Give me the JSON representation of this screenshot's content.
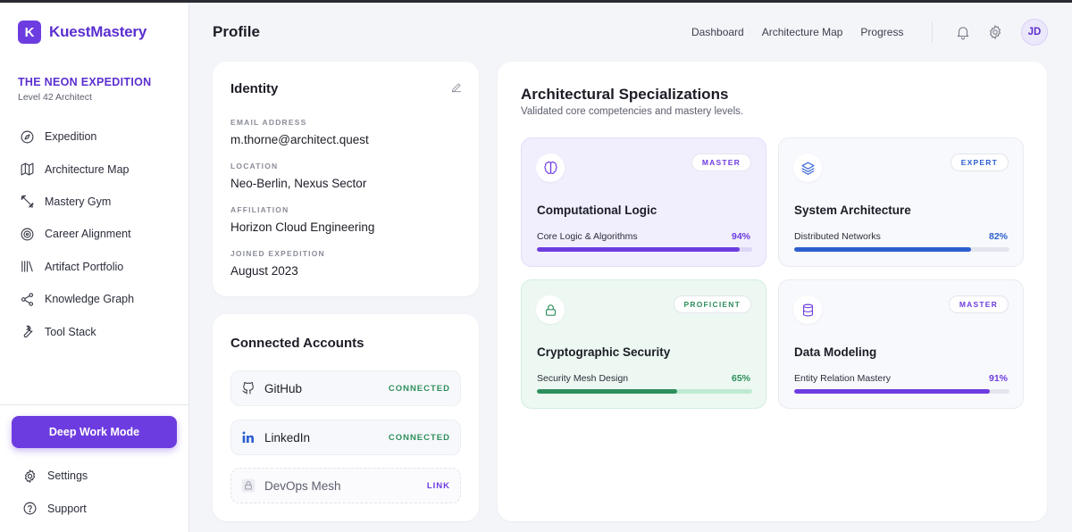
{
  "brand": {
    "logo_letter": "K",
    "name": "KuestMastery"
  },
  "expedition": {
    "title": "THE NEON EXPEDITION",
    "subtitle": "Level 42 Architect"
  },
  "sidebar": {
    "items": [
      {
        "label": "Expedition",
        "icon": "compass-icon"
      },
      {
        "label": "Architecture Map",
        "icon": "map-icon"
      },
      {
        "label": "Mastery Gym",
        "icon": "dumbbell-icon"
      },
      {
        "label": "Career Alignment",
        "icon": "target-icon"
      },
      {
        "label": "Artifact Portfolio",
        "icon": "library-icon"
      },
      {
        "label": "Knowledge Graph",
        "icon": "share-icon"
      },
      {
        "label": "Tool Stack",
        "icon": "wrench-icon"
      }
    ],
    "deep_work_label": "Deep Work Mode",
    "bottom_items": [
      {
        "label": "Settings",
        "icon": "gear-icon"
      },
      {
        "label": "Support",
        "icon": "help-icon"
      }
    ]
  },
  "header": {
    "title": "Profile",
    "nav": [
      "Dashboard",
      "Architecture Map",
      "Progress"
    ],
    "avatar_initials": "JD"
  },
  "identity": {
    "title": "Identity",
    "fields": [
      {
        "label": "EMAIL ADDRESS",
        "value": "m.thorne@architect.quest"
      },
      {
        "label": "LOCATION",
        "value": "Neo-Berlin, Nexus Sector"
      },
      {
        "label": "AFFILIATION",
        "value": "Horizon Cloud Engineering"
      },
      {
        "label": "JOINED EXPEDITION",
        "value": "August 2023"
      }
    ]
  },
  "accounts": {
    "title": "Connected Accounts",
    "items": [
      {
        "name": "GitHub",
        "status": "CONNECTED",
        "icon": "github-icon"
      },
      {
        "name": "LinkedIn",
        "status": "CONNECTED",
        "icon": "linkedin-icon"
      },
      {
        "name": "DevOps Mesh",
        "status": "LINK",
        "icon": "lock-icon"
      }
    ]
  },
  "specializations": {
    "title": "Architectural Specializations",
    "subtitle": "Validated core competencies and mastery levels.",
    "tiles": [
      {
        "name": "Computational Logic",
        "badge": "MASTER",
        "skill": "Core Logic & Algorithms",
        "percent_label": "94%",
        "progress": 0.94,
        "icon": "brain-icon",
        "accent": "#6d3ce0"
      },
      {
        "name": "System Architecture",
        "badge": "EXPERT",
        "skill": "Distributed Networks",
        "percent_label": "82%",
        "progress": 0.82,
        "icon": "layers-icon",
        "accent": "#2d5fd0"
      },
      {
        "name": "Cryptographic Security",
        "badge": "PROFICIENT",
        "skill": "Security Mesh Design",
        "percent_label": "65%",
        "progress": 0.65,
        "icon": "lock-icon",
        "accent": "#2e8f5c"
      },
      {
        "name": "Data Modeling",
        "badge": "MASTER",
        "skill": "Entity Relation Mastery",
        "percent_label": "91%",
        "progress": 0.91,
        "icon": "database-icon",
        "accent": "#6d3ce0"
      }
    ]
  },
  "colors": {
    "brand": "#6d3ce0",
    "success": "#2e8f5c",
    "blue": "#2d5fd0"
  }
}
